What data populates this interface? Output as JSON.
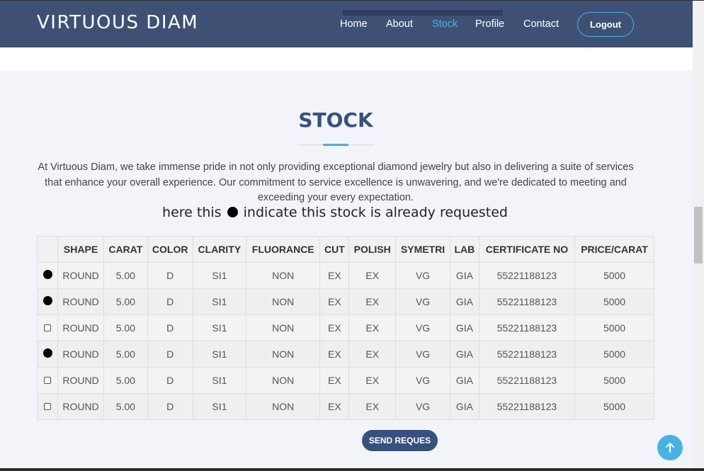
{
  "nav": {
    "brand": "VIRTUOUS DIAM",
    "links": [
      {
        "label": "Home",
        "active": false
      },
      {
        "label": "About",
        "active": false
      },
      {
        "label": "Stock",
        "active": true
      },
      {
        "label": "Profile",
        "active": false
      },
      {
        "label": "Contact",
        "active": false
      }
    ],
    "logout_label": "Logout"
  },
  "section": {
    "title": "STOCK",
    "intro": "At Virtuous Diam, we take immense pride in not only providing exceptional diamond jewelry but also in delivering a suite of services that enhance your overall experience. Our commitment to service excellence is unwavering, and we're dedicated to meeting and exceeding your every expectation.",
    "note_before": "here this",
    "note_after": "indicate this stock is already requested"
  },
  "table": {
    "headers": [
      "",
      "SHAPE",
      "CARAT",
      "COLOR",
      "CLARITY",
      "FLUORANCE",
      "CUT",
      "POLISH",
      "SYMETRI",
      "LAB",
      "CERTIFICATE NO",
      "PRICE/CARAT"
    ],
    "rows": [
      {
        "requested": true,
        "cells": [
          "ROUND",
          "5.00",
          "D",
          "SI1",
          "NON",
          "EX",
          "EX",
          "VG",
          "GIA",
          "55221188123",
          "5000"
        ]
      },
      {
        "requested": true,
        "cells": [
          "ROUND",
          "5.00",
          "D",
          "SI1",
          "NON",
          "EX",
          "EX",
          "VG",
          "GIA",
          "55221188123",
          "5000"
        ]
      },
      {
        "requested": false,
        "cells": [
          "ROUND",
          "5.00",
          "D",
          "SI1",
          "NON",
          "EX",
          "EX",
          "VG",
          "GIA",
          "55221188123",
          "5000"
        ]
      },
      {
        "requested": true,
        "cells": [
          "ROUND",
          "5.00",
          "D",
          "SI1",
          "NON",
          "EX",
          "EX",
          "VG",
          "GIA",
          "55221188123",
          "5000"
        ]
      },
      {
        "requested": false,
        "cells": [
          "ROUND",
          "5.00",
          "D",
          "SI1",
          "NON",
          "EX",
          "EX",
          "VG",
          "GIA",
          "55221188123",
          "5000"
        ]
      },
      {
        "requested": false,
        "cells": [
          "ROUND",
          "5.00",
          "D",
          "SI1",
          "NON",
          "EX",
          "EX",
          "VG",
          "GIA",
          "55221188123",
          "5000"
        ]
      }
    ]
  },
  "send_button_label": "SEND REQUES",
  "icons": {
    "back_to_top": "arrow-up-icon",
    "requested": "filled-circle-icon",
    "available": "checkbox-icon"
  },
  "colors": {
    "navbar": "#3e5174",
    "accent": "#47b2e4",
    "title": "#37517e",
    "button": "#37517e"
  }
}
